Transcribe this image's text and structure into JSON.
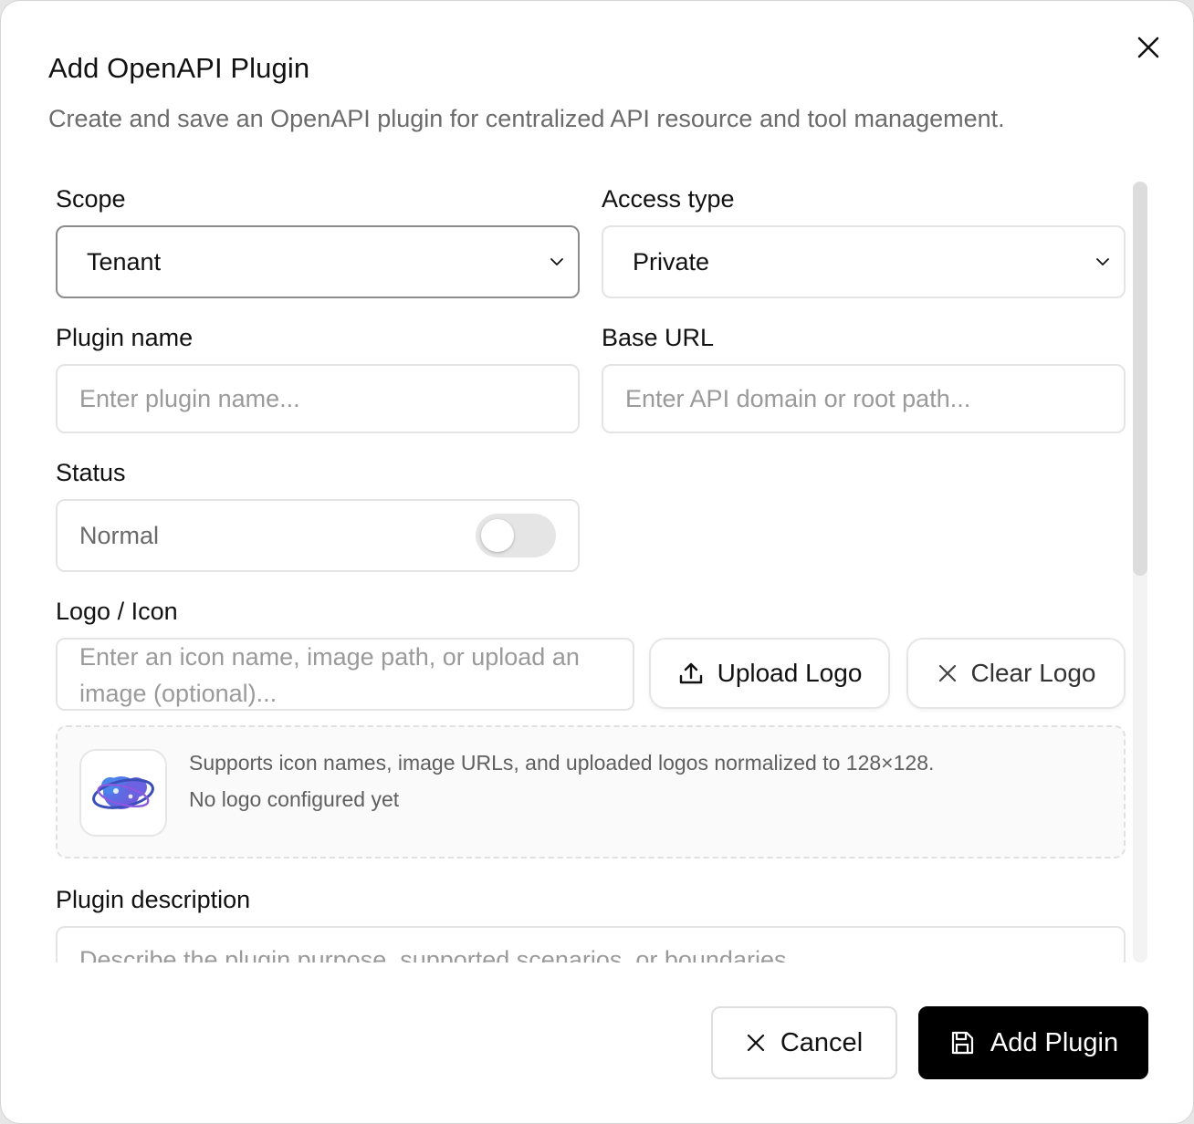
{
  "dialog": {
    "title": "Add OpenAPI Plugin",
    "subtitle": "Create and save an OpenAPI plugin for centralized API resource and tool management."
  },
  "form": {
    "scope": {
      "label": "Scope",
      "value": "Tenant"
    },
    "access_type": {
      "label": "Access type",
      "value": "Private"
    },
    "plugin_name": {
      "label": "Plugin name",
      "placeholder": "Enter plugin name..."
    },
    "base_url": {
      "label": "Base URL",
      "placeholder": "Enter API domain or root path..."
    },
    "status": {
      "label": "Status",
      "value": "Normal",
      "enabled": false
    },
    "logo": {
      "label": "Logo / Icon",
      "placeholder": "Enter an icon name, image path, or upload an image (optional)...",
      "upload_label": "Upload Logo",
      "clear_label": "Clear Logo",
      "hint": "Supports icon names, image URLs, and uploaded logos normalized to 128×128.",
      "state": "No logo configured yet"
    },
    "description": {
      "label": "Plugin description",
      "placeholder": "Describe the plugin purpose, supported scenarios, or boundaries..."
    }
  },
  "footer": {
    "cancel_label": "Cancel",
    "submit_label": "Add Plugin"
  },
  "icons": {
    "close": "close-icon",
    "chevron": "chevron-down-icon",
    "upload": "upload-icon",
    "clear": "x-icon",
    "save": "save-icon",
    "logo": "plugin-logo-icon"
  },
  "colors": {
    "primary_button": "#000000",
    "accent_logo_blue": "#4a7fe0",
    "accent_logo_purple": "#7b4ed8"
  }
}
